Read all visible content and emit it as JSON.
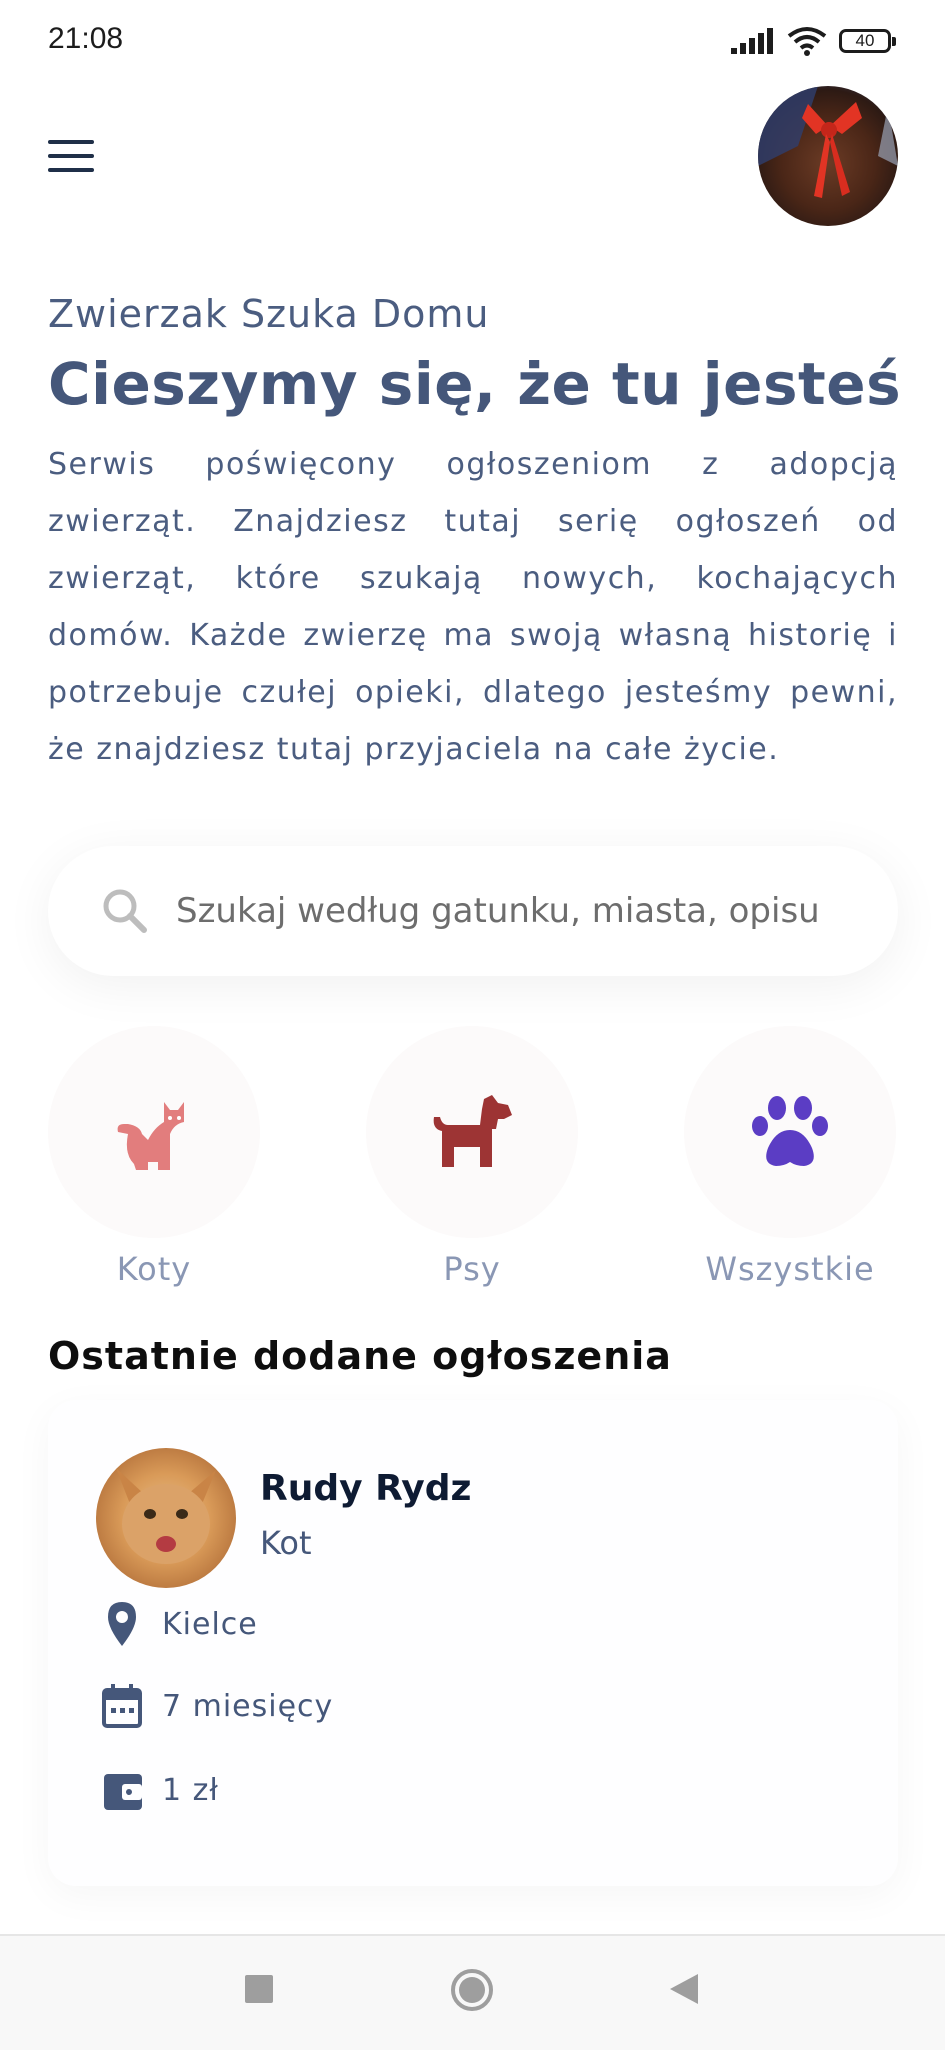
{
  "status_bar": {
    "time": "21:08",
    "battery": "40"
  },
  "header": {
    "menu_icon": "hamburger-menu-icon",
    "avatar_icon": "user-avatar"
  },
  "intro": {
    "subtitle": "Zwierzak Szuka Domu",
    "title": "Cieszymy się, że tu jesteś",
    "description": "Serwis poświęcony ogłoszeniom z adopcją zwierząt. Znajdziesz tutaj serię ogłoszeń od zwierząt, które szukają nowych, kochających domów. Każde zwierzę ma swoją własną historię i potrzebuje czułej opieki, dlatego jesteśmy pewni, że znajdziesz tutaj przyjaciela na całe życie."
  },
  "search": {
    "placeholder": "Szukaj według gatunku, miasta, opisu",
    "value": ""
  },
  "categories": [
    {
      "label": "Koty",
      "icon": "cat-icon",
      "color": "#e27d7d"
    },
    {
      "label": "Psy",
      "icon": "dog-icon",
      "color": "#9d3434"
    },
    {
      "label": "Wszystkie",
      "icon": "paw-icon",
      "color": "#5b3dc4"
    }
  ],
  "recent": {
    "title": "Ostatnie dodane ogłoszenia",
    "listings": [
      {
        "name": "Rudy Rydz",
        "species": "Kot",
        "location": "Kielce",
        "age": "7 miesięcy",
        "price": "1 zł"
      }
    ]
  },
  "colors": {
    "primary_text": "#45577a",
    "category_label": "#8a97b4"
  }
}
